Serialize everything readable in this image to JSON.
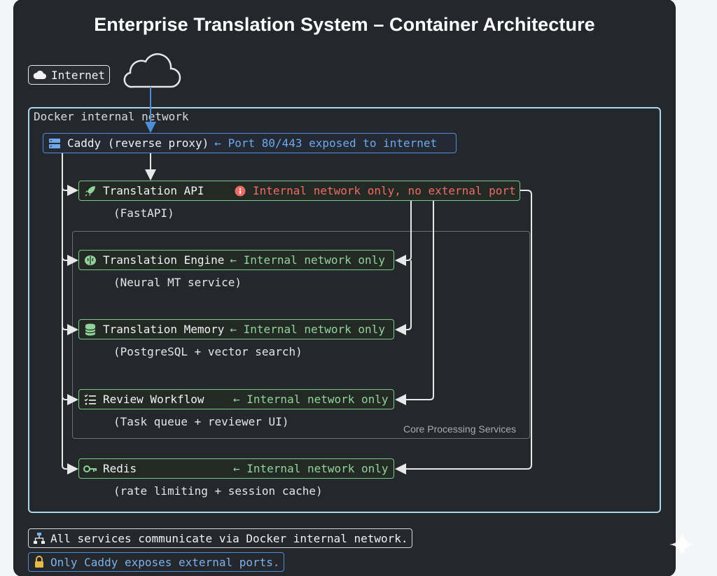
{
  "title": "Enterprise Translation System – Container Architecture",
  "internet": {
    "label": "Internet",
    "icon": "cloud-icon"
  },
  "network": {
    "label": "Docker internal network"
  },
  "core_group": {
    "label": "Core Processing Services"
  },
  "caddy": {
    "label": "Caddy (reverse proxy)",
    "note": "← Port 80/443 exposed to internet",
    "icon": "server-icon"
  },
  "services": [
    {
      "label": "Translation API",
      "note": "Internal network only, no external port",
      "sub": "(FastAPI)",
      "icon": "rocket-icon"
    },
    {
      "label": "Translation Engine",
      "note": "← Internal network only",
      "sub": "(Neural MT service)",
      "icon": "brain-icon"
    },
    {
      "label": "Translation Memory",
      "note": "← Internal network only",
      "sub": "(PostgreSQL + vector search)",
      "icon": "database-icon"
    },
    {
      "label": "Review Workflow",
      "note": "← Internal network only",
      "sub": "(Task queue + reviewer UI)",
      "icon": "checklist-icon"
    },
    {
      "label": "Redis",
      "note": "← Internal network only",
      "sub": "(rate limiting + session cache)",
      "icon": "key-icon"
    }
  ],
  "footer": [
    {
      "text": "All services communicate via Docker internal network.",
      "icon": "network-icon"
    },
    {
      "text": "Only Caddy exposes external ports.",
      "icon": "lock-icon"
    }
  ],
  "colors": {
    "panel": "#24272b",
    "network_border": "#a9d6e8",
    "service_border": "#7fc989",
    "proxy_border": "#4c8fd8",
    "warning": "#ef6b63"
  }
}
